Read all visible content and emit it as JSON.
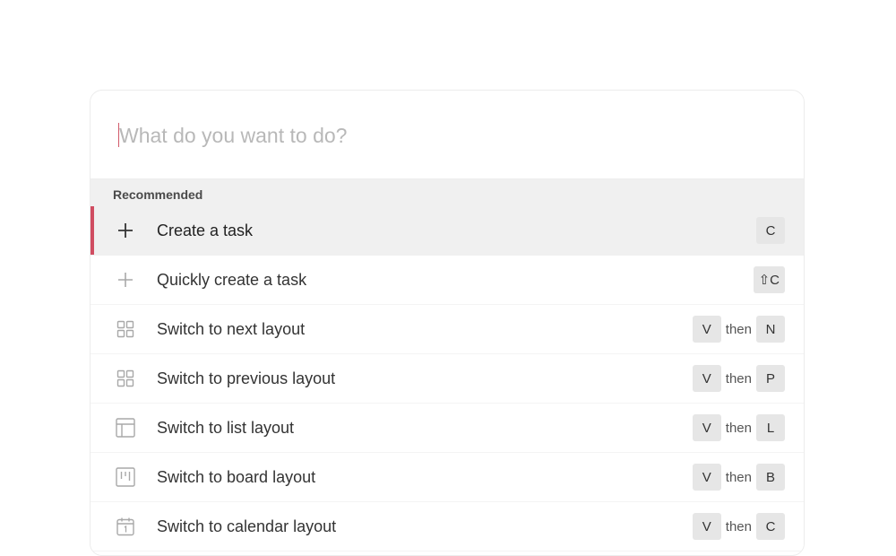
{
  "search": {
    "placeholder": "What do you want to do?"
  },
  "section": {
    "title": "Recommended"
  },
  "items": [
    {
      "label": "Create a task",
      "icon": "plus-icon",
      "keys": [
        "C"
      ],
      "then": "",
      "active": true
    },
    {
      "label": "Quickly create a task",
      "icon": "plus-light-icon",
      "keys": [
        "⇧C"
      ],
      "then": ""
    },
    {
      "label": "Switch to next layout",
      "icon": "grid-icon",
      "keys": [
        "V",
        "N"
      ],
      "then": "then"
    },
    {
      "label": "Switch to previous layout",
      "icon": "grid-icon",
      "keys": [
        "V",
        "P"
      ],
      "then": "then"
    },
    {
      "label": "Switch to list layout",
      "icon": "list-layout-icon",
      "keys": [
        "V",
        "L"
      ],
      "then": "then"
    },
    {
      "label": "Switch to board layout",
      "icon": "board-layout-icon",
      "keys": [
        "V",
        "B"
      ],
      "then": "then"
    },
    {
      "label": "Switch to calendar layout",
      "icon": "calendar-icon",
      "keys": [
        "V",
        "C"
      ],
      "then": "then"
    }
  ],
  "colors": {
    "accent": "#d04d61",
    "highlight": "#f0f0f0",
    "key_bg": "#e6e6e6"
  }
}
